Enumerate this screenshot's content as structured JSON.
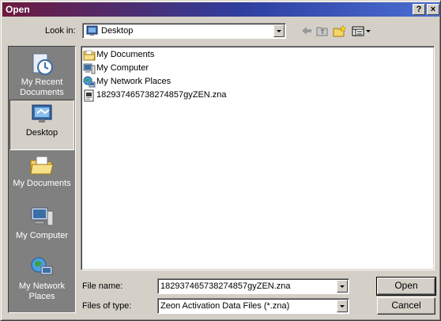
{
  "window": {
    "title": "Open",
    "help_label": "?",
    "close_label": "×"
  },
  "lookin": {
    "label": "Look in:",
    "value": "Desktop",
    "icon": "desktop-icon"
  },
  "toolbar": {
    "icons": [
      "back-arrow-icon",
      "up-folder-icon",
      "new-folder-icon",
      "view-menu-icon"
    ]
  },
  "places": [
    {
      "label": "My Recent Documents",
      "icon": "recent-documents-icon"
    },
    {
      "label": "Desktop",
      "icon": "desktop-icon",
      "selected": true
    },
    {
      "label": "My Documents",
      "icon": "my-documents-icon"
    },
    {
      "label": "My Computer",
      "icon": "my-computer-icon"
    },
    {
      "label": "My Network Places",
      "icon": "network-places-icon"
    }
  ],
  "files": [
    {
      "name": "My Documents",
      "icon": "folder-icon"
    },
    {
      "name": "My Computer",
      "icon": "computer-icon"
    },
    {
      "name": "My Network Places",
      "icon": "network-icon"
    },
    {
      "name": "182937465738274857gyZEN.zna",
      "icon": "file-icon"
    }
  ],
  "form": {
    "file_name_label": "File name:",
    "file_name_value": "182937465738274857gyZEN.zna",
    "file_type_label": "Files of type:",
    "file_type_value": "Zeon Activation Data Files (*.zna)"
  },
  "buttons": {
    "open": "Open",
    "cancel": "Cancel"
  }
}
